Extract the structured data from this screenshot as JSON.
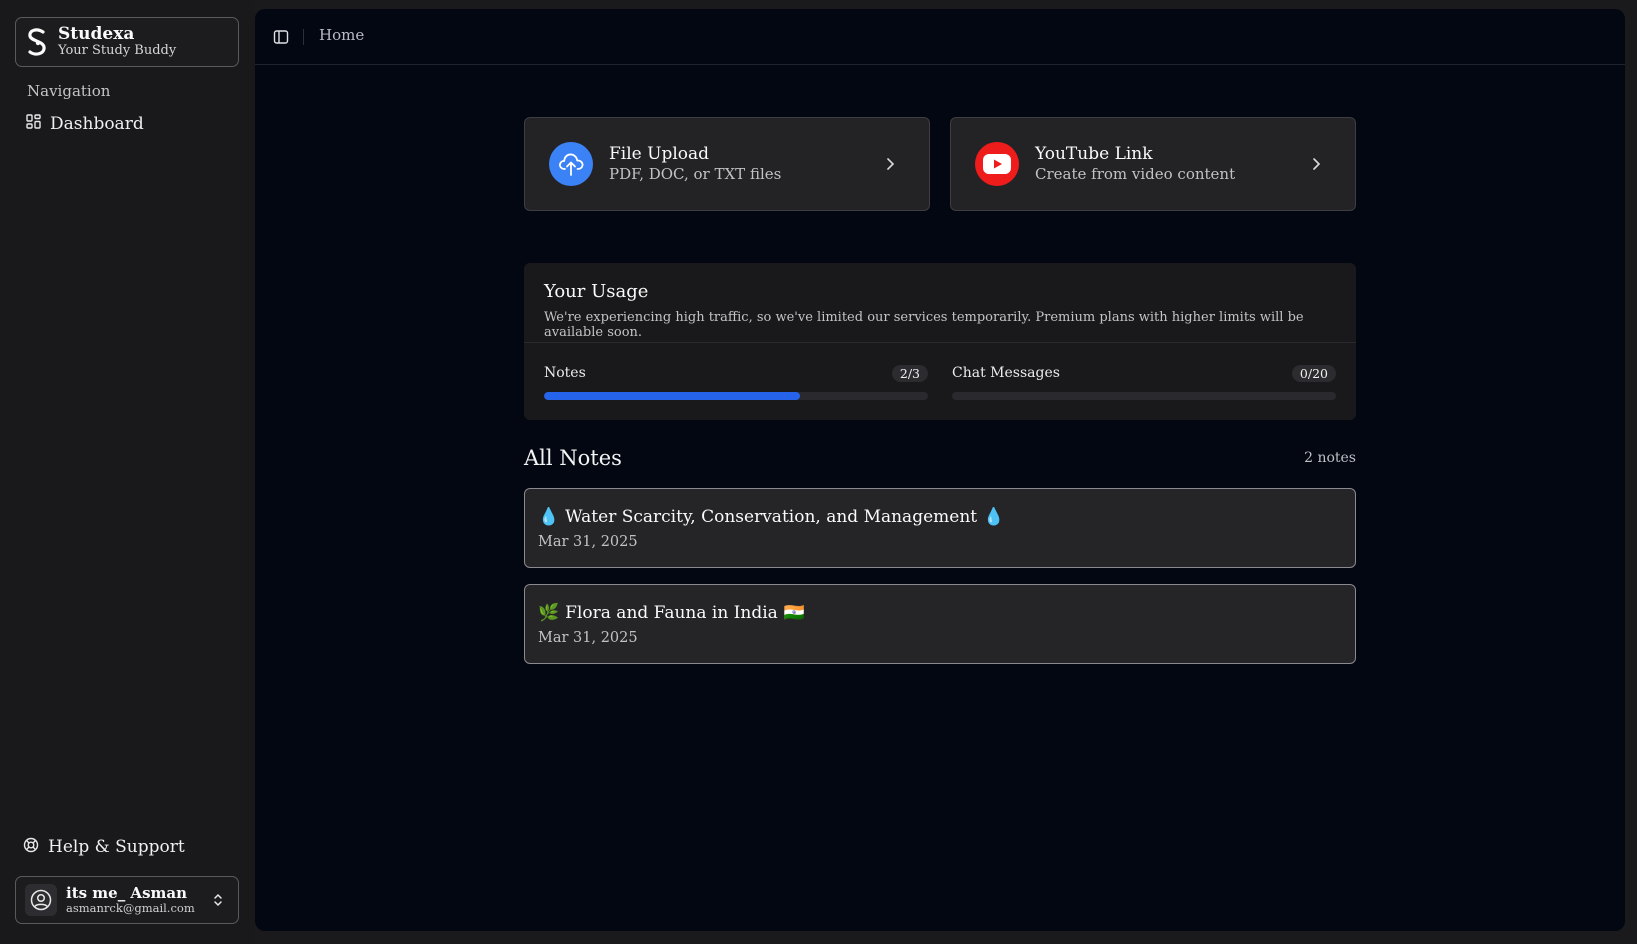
{
  "sidebar": {
    "brand": {
      "name": "Studexa",
      "tagline": "Your Study Buddy"
    },
    "nav_label": "Navigation",
    "nav_items": [
      {
        "label": "Dashboard",
        "icon": "dashboard-icon"
      }
    ],
    "help_label": "Help & Support",
    "user": {
      "name": "its me_ Asman",
      "email": "asmanrck@gmail.com"
    }
  },
  "topbar": {
    "breadcrumb": "Home"
  },
  "cards": [
    {
      "title": "File Upload",
      "subtitle": "PDF, DOC, or TXT files",
      "icon": "cloud-upload-icon",
      "color": "#3b82f6"
    },
    {
      "title": "YouTube Link",
      "subtitle": "Create from video content",
      "icon": "youtube-icon",
      "color": "#ef1c1c"
    }
  ],
  "usage": {
    "title": "Your Usage",
    "description": "We're experiencing high traffic, so we've limited our services temporarily. Premium plans with higher limits will be available soon.",
    "meters": [
      {
        "label": "Notes",
        "badge": "2/3",
        "fraction": 0.6667
      },
      {
        "label": "Chat Messages",
        "badge": "0/20",
        "fraction": 0
      }
    ]
  },
  "notes": {
    "title": "All Notes",
    "count": "2 notes",
    "items": [
      {
        "emoji_start": "💧",
        "title": "Water Scarcity, Conservation, and Management",
        "emoji_end": "💧",
        "date": "Mar 31, 2025"
      },
      {
        "emoji_start": "🌿",
        "title": "Flora and Fauna in India",
        "emoji_end": "🇮🇳",
        "date": "Mar 31, 2025"
      }
    ]
  },
  "colors": {
    "accent": "#2563eb",
    "background": "#030712"
  }
}
